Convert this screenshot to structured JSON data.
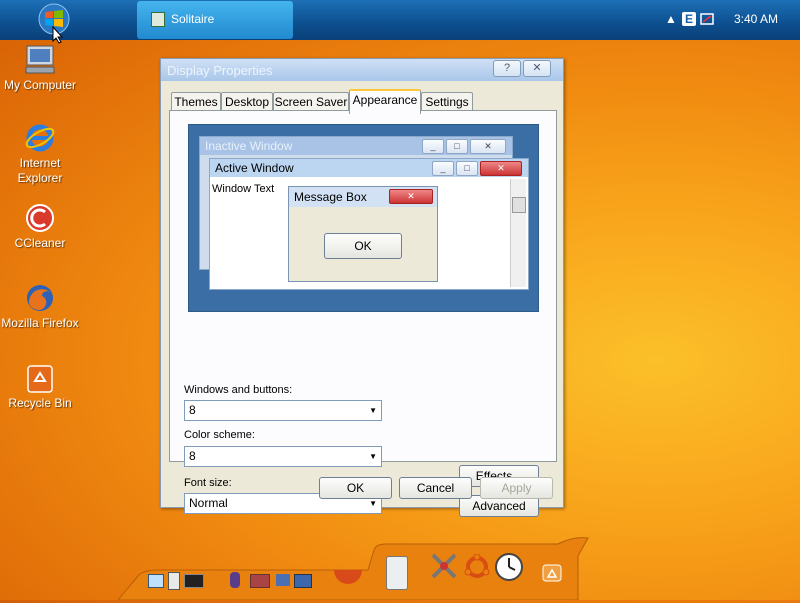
{
  "taskbar": {
    "task_label": "Solitaire",
    "clock": "3:40 AM",
    "tray_e": "E"
  },
  "desktop_icons": [
    {
      "label": "My Computer"
    },
    {
      "label": "Internet Explorer"
    },
    {
      "label": "CCleaner"
    },
    {
      "label": "Mozilla Firefox"
    },
    {
      "label": "Recycle Bin"
    }
  ],
  "dialog": {
    "title": "Display Properties",
    "help_glyph": "?",
    "close_glyph": "✕",
    "tabs": [
      {
        "label": "Themes"
      },
      {
        "label": "Desktop"
      },
      {
        "label": "Screen Saver"
      },
      {
        "label": "Appearance",
        "active": true
      },
      {
        "label": "Settings"
      }
    ],
    "preview": {
      "inactive_title": "Inactive Window",
      "active_title": "Active Window",
      "window_text": "Window Text",
      "message_title": "Message Box",
      "ok_label": "OK"
    },
    "windows_buttons": {
      "label": "Windows and buttons:",
      "value": "8"
    },
    "color_scheme": {
      "label": "Color scheme:",
      "value": "8"
    },
    "font_size": {
      "label": "Font size:",
      "value": "Normal"
    },
    "effects_label": "Effects...",
    "advanced_label": "Advanced",
    "ok_label": "OK",
    "cancel_label": "Cancel",
    "apply_label": "Apply"
  },
  "colors": {
    "accent": "#2289cf",
    "title_bar": "#a9c7ea",
    "desktop": "#f39a16"
  }
}
